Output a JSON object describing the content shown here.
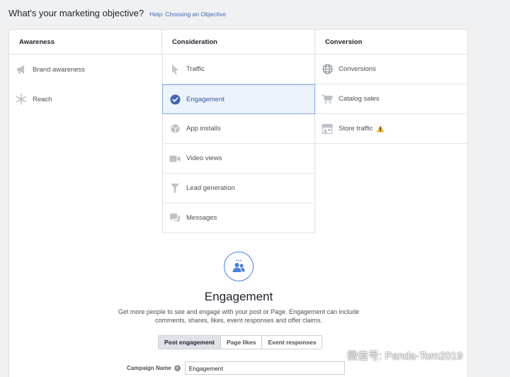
{
  "header": {
    "question": "What's your marketing objective?",
    "help_link": "Help: Choosing an Objective"
  },
  "columns": [
    {
      "title": "Awareness",
      "items": [
        {
          "label": "Brand awareness",
          "icon": "megaphone-icon"
        },
        {
          "label": "Reach",
          "icon": "snowflake-icon"
        }
      ]
    },
    {
      "title": "Consideration",
      "items": [
        {
          "label": "Traffic",
          "icon": "cursor-icon"
        },
        {
          "label": "Engagement",
          "icon": "check-circle-icon",
          "selected": true
        },
        {
          "label": "App installs",
          "icon": "box-icon"
        },
        {
          "label": "Video views",
          "icon": "video-camera-icon"
        },
        {
          "label": "Lead generation",
          "icon": "funnel-icon"
        },
        {
          "label": "Messages",
          "icon": "chat-bubbles-icon"
        }
      ]
    },
    {
      "title": "Conversion",
      "items": [
        {
          "label": "Conversions",
          "icon": "globe-icon"
        },
        {
          "label": "Catalog sales",
          "icon": "cart-icon"
        },
        {
          "label": "Store traffic",
          "icon": "store-icon",
          "warning": true
        }
      ]
    }
  ],
  "detail": {
    "title": "Engagement",
    "icon": "people-icon",
    "description": "Get more people to see and engage with your post or Page. Engagement can include comments, shares, likes, event responses and offer claims.",
    "tabs": [
      {
        "label": "Post engagement",
        "active": true
      },
      {
        "label": "Page likes",
        "active": false
      },
      {
        "label": "Event responses",
        "active": false
      }
    ],
    "campaign_name_label": "Campaign Name",
    "campaign_name_value": "Engagement"
  },
  "watermark": {
    "text": "微信号: Panda-Tom2019",
    "icon": "wechat-icon"
  },
  "colors": {
    "accent": "#4267b2",
    "selected_bg": "#edf3fb",
    "warning": "#f7b928"
  }
}
